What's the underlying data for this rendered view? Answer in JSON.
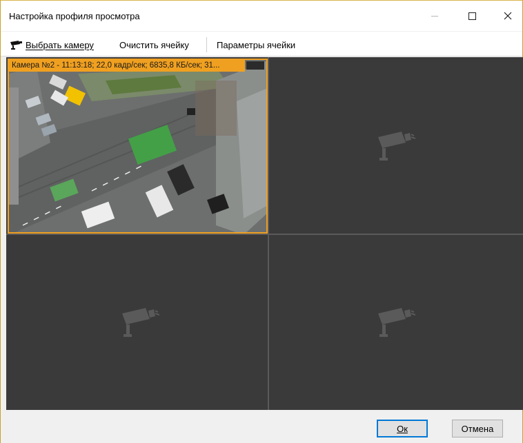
{
  "window": {
    "title": "Настройка профиля просмотра"
  },
  "toolbar": {
    "select_camera": "Выбрать камеру",
    "clear_cell": "Очистить ячейку",
    "cell_params": "Параметры ячейки"
  },
  "grid": {
    "active_cell_label": "Камера №2 - 11:13:18; 22,0 кадр/сек; 6835,8 КБ/сек; 31...",
    "active_color": "#f0a020"
  },
  "footer": {
    "ok_label": "Ок",
    "cancel_label": "Отмена"
  },
  "icons": {
    "camera": "camera-icon",
    "placeholder": "camera-placeholder-icon"
  }
}
